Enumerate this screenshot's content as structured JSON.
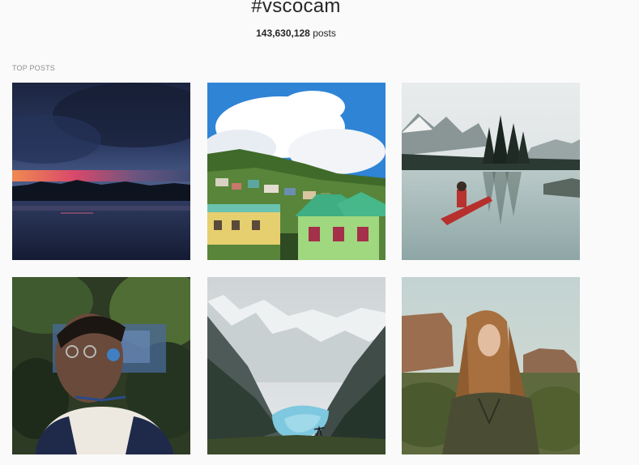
{
  "header": {
    "hashtag": "#vscocam",
    "post_count_number": "143,630,128",
    "post_count_suffix": " posts"
  },
  "section": {
    "label": "TOP POSTS"
  },
  "posts": [
    {
      "subject": "sunset-over-lake-photo"
    },
    {
      "subject": "hillside-village-photo"
    },
    {
      "subject": "canoe-on-mountain-lake-photo"
    },
    {
      "subject": "double-exposure-portrait-photo"
    },
    {
      "subject": "alpine-valley-lake-photo"
    },
    {
      "subject": "woman-desert-mesa-photo"
    }
  ]
}
